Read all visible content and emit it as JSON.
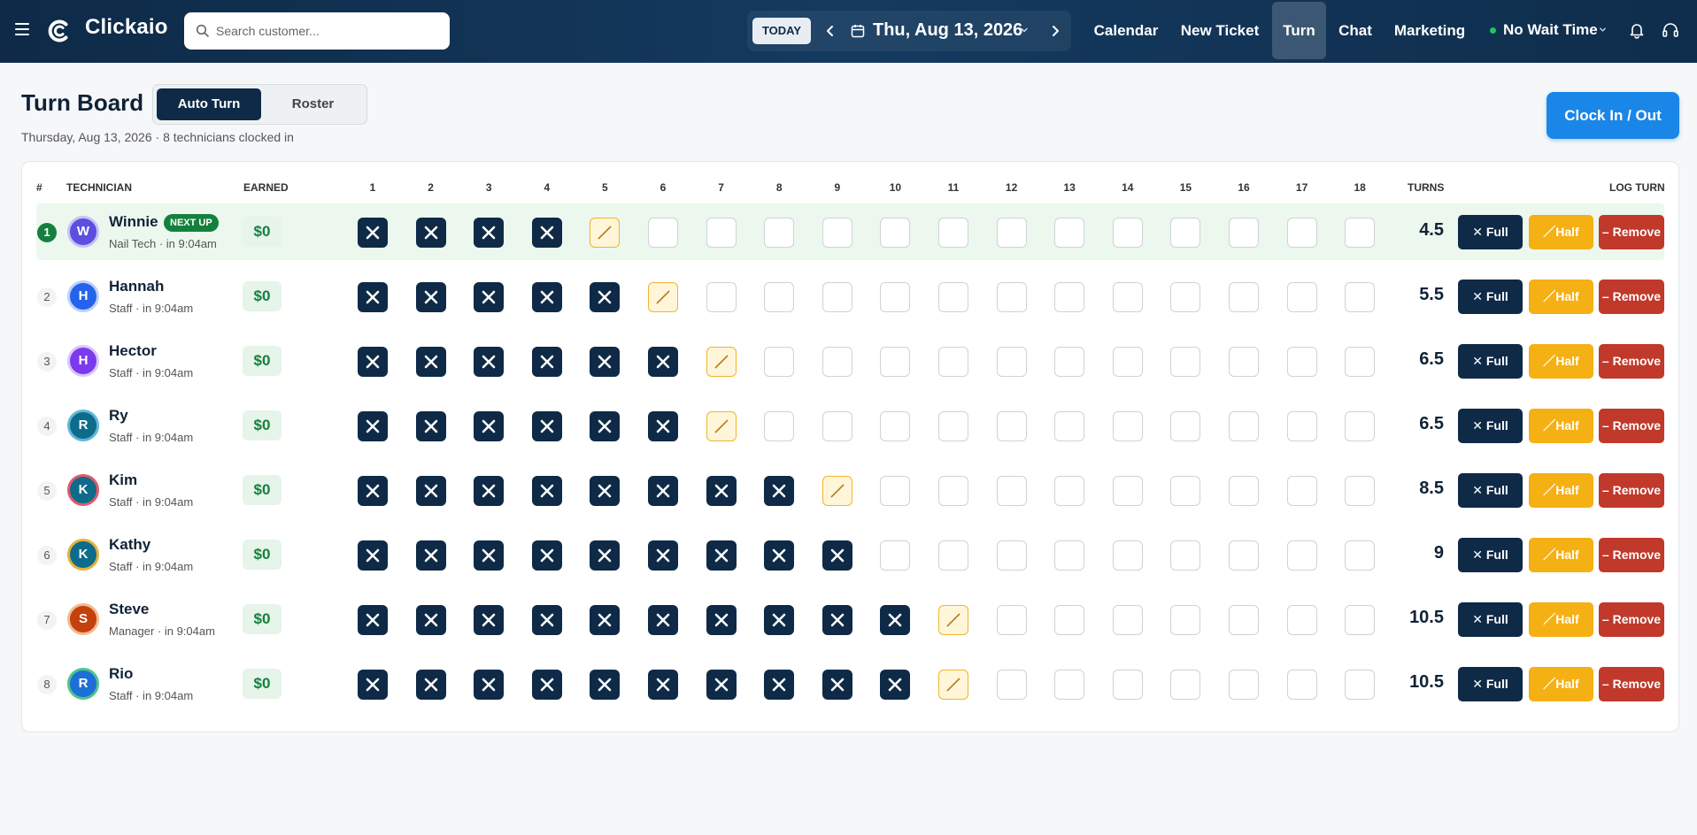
{
  "app": {
    "name": "Clickaio"
  },
  "search": {
    "placeholder": "Search customer..."
  },
  "date_nav": {
    "today_label": "TODAY",
    "date": "Thu, Aug 13, 2026"
  },
  "nav": [
    {
      "label": "Calendar",
      "active": false
    },
    {
      "label": "New Ticket",
      "active": false
    },
    {
      "label": "Turn",
      "active": true
    },
    {
      "label": "Chat",
      "active": false
    },
    {
      "label": "Marketing",
      "active": false
    }
  ],
  "wait_status": {
    "label": "No Wait Time",
    "color": "#22c55e"
  },
  "page": {
    "title": "Turn Board",
    "modes": [
      "Auto Turn",
      "Roster"
    ],
    "active_mode": "Auto Turn",
    "subtitle": "Thursday, Aug 13, 2026 · 8 technicians clocked in",
    "clock_button": "Clock In / Out"
  },
  "table": {
    "headers": {
      "rank": "#",
      "technician": "TECHNICIAN",
      "earned": "EARNED",
      "turns": "TURNS",
      "log": "LOG TURN"
    },
    "slot_labels": [
      "1",
      "2",
      "3",
      "4",
      "5",
      "6",
      "7",
      "8",
      "9",
      "10",
      "11",
      "12",
      "13",
      "14",
      "15",
      "16",
      "17",
      "18"
    ],
    "actions": {
      "full": "Full",
      "half": "Half",
      "remove": "Remove"
    },
    "next_badge": "NEXT UP",
    "rows": [
      {
        "rank": "1",
        "initial": "W",
        "name": "Winnie",
        "subtitle": "Nail Tech · in 9:04am",
        "earned": "$0",
        "turns": "4.5",
        "full_turns": 4,
        "half_turn": true,
        "next_up": true,
        "avatar_color": "#5b4fe0",
        "avatar_ring": "#c7c2f5"
      },
      {
        "rank": "2",
        "initial": "H",
        "name": "Hannah",
        "subtitle": "Staff · in 9:04am",
        "earned": "$0",
        "turns": "5.5",
        "full_turns": 5,
        "half_turn": true,
        "next_up": false,
        "avatar_color": "#2563eb",
        "avatar_ring": "#bcd0fb"
      },
      {
        "rank": "3",
        "initial": "H",
        "name": "Hector",
        "subtitle": "Staff · in 9:04am",
        "earned": "$0",
        "turns": "6.5",
        "full_turns": 6,
        "half_turn": true,
        "next_up": false,
        "avatar_color": "#7c3aed",
        "avatar_ring": "#d9c7fb"
      },
      {
        "rank": "4",
        "initial": "R",
        "name": "Ry",
        "subtitle": "Staff · in 9:04am",
        "earned": "$0",
        "turns": "6.5",
        "full_turns": 6,
        "half_turn": true,
        "next_up": false,
        "avatar_color": "#0f6b8a",
        "avatar_ring": "#63b6d6"
      },
      {
        "rank": "5",
        "initial": "K",
        "name": "Kim",
        "subtitle": "Staff · in 9:04am",
        "earned": "$0",
        "turns": "8.5",
        "full_turns": 8,
        "half_turn": true,
        "next_up": false,
        "avatar_color": "#0f6b8a",
        "avatar_ring": "#e05a6a"
      },
      {
        "rank": "6",
        "initial": "K",
        "name": "Kathy",
        "subtitle": "Staff · in 9:04am",
        "earned": "$0",
        "turns": "9",
        "full_turns": 9,
        "half_turn": false,
        "next_up": false,
        "avatar_color": "#0f6b8a",
        "avatar_ring": "#e3b23c"
      },
      {
        "rank": "7",
        "initial": "S",
        "name": "Steve",
        "subtitle": "Manager · in 9:04am",
        "earned": "$0",
        "turns": "10.5",
        "full_turns": 10,
        "half_turn": true,
        "next_up": false,
        "avatar_color": "#c2410c",
        "avatar_ring": "#f3b98f"
      },
      {
        "rank": "8",
        "initial": "R",
        "name": "Rio",
        "subtitle": "Staff · in 9:04am",
        "earned": "$0",
        "turns": "10.5",
        "full_turns": 10,
        "half_turn": true,
        "next_up": false,
        "avatar_color": "#1d6fd6",
        "avatar_ring": "#4ec38b"
      }
    ]
  },
  "colors": {
    "navy": "#0e2a47",
    "accent_blue": "#1a86e8",
    "green": "#15803d",
    "amber": "#f5b014",
    "red": "#c0392b"
  },
  "icons": [
    "menu-icon",
    "clickaio-logo-icon",
    "search-icon",
    "chevron-left-icon",
    "calendar-icon",
    "chevron-down-icon",
    "chevron-right-icon",
    "bell-icon",
    "headset-icon"
  ]
}
